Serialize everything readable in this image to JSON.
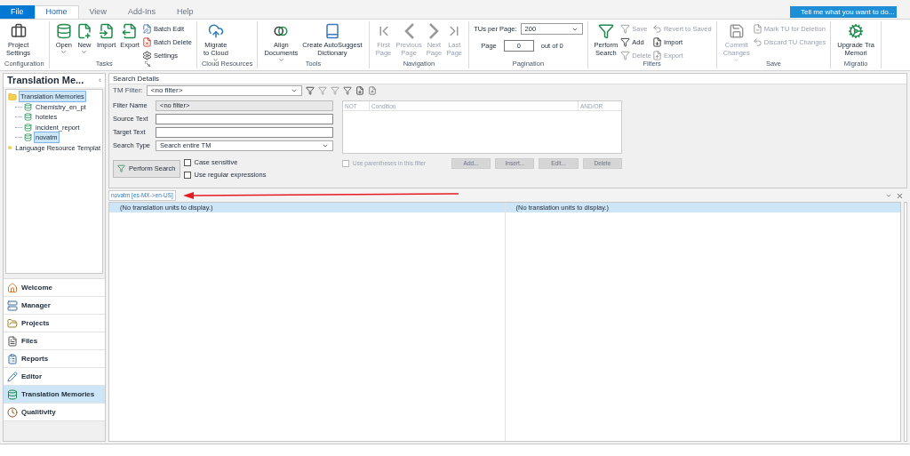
{
  "tabs": [
    {
      "label": "File",
      "kind": "file",
      "selected": false
    },
    {
      "label": "Home",
      "kind": "tab",
      "selected": true
    },
    {
      "label": "View",
      "kind": "tab",
      "selected": false
    },
    {
      "label": "Add-Ins",
      "kind": "tab",
      "selected": false
    },
    {
      "label": "Help",
      "kind": "tab",
      "selected": false
    }
  ],
  "tell_me": "Tell me what you want to do...",
  "ribbon": {
    "groups": [
      {
        "label": "Configuration",
        "items": [
          {
            "kind": "large",
            "lines": [
              "Project",
              "Settings"
            ],
            "disabled": false
          }
        ]
      },
      {
        "label": "Tasks",
        "launcher": true,
        "items": [
          {
            "kind": "large",
            "lines": [
              "Open"
            ],
            "dropdown": true,
            "disabled": false
          },
          {
            "kind": "large",
            "lines": [
              "New"
            ],
            "dropdown": true,
            "disabled": false
          },
          {
            "kind": "large",
            "lines": [
              "Import"
            ],
            "disabled": false
          },
          {
            "kind": "large",
            "lines": [
              "Export"
            ],
            "disabled": false
          },
          {
            "kind": "column",
            "items": [
              {
                "label": "Batch Edit",
                "disabled": false
              },
              {
                "label": "Batch Delete",
                "disabled": false
              },
              {
                "label": "Settings",
                "disabled": false
              }
            ]
          }
        ]
      },
      {
        "label": "Cloud Resources",
        "items": [
          {
            "kind": "large",
            "lines": [
              "Migrate",
              "to Cloud"
            ],
            "dropdown": true,
            "disabled": false
          }
        ]
      },
      {
        "label": "Tools",
        "items": [
          {
            "kind": "large",
            "lines": [
              "Align",
              "Documents"
            ],
            "dropdown": true,
            "disabled": false
          },
          {
            "kind": "large",
            "lines": [
              "Create AutoSuggest",
              "Dictionary"
            ],
            "disabled": false
          }
        ]
      },
      {
        "label": "Navigation",
        "items": [
          {
            "kind": "large",
            "lines": [
              "First",
              "Page"
            ],
            "disabled": true
          },
          {
            "kind": "large",
            "lines": [
              "Previous",
              "Page"
            ],
            "disabled": true
          },
          {
            "kind": "large",
            "lines": [
              "Next",
              "Page"
            ],
            "disabled": true
          },
          {
            "kind": "large",
            "lines": [
              "Last",
              "Page"
            ],
            "disabled": true
          }
        ]
      },
      {
        "label": "Pagination",
        "items": [
          {
            "kind": "pager",
            "per_page_label": "TUs per Page:",
            "per_page": "200",
            "page_label": "Page",
            "page": "0",
            "total": "out of 0"
          }
        ]
      },
      {
        "label": "Filters",
        "items": [
          {
            "kind": "large",
            "lines": [
              "Perform",
              "Search"
            ],
            "disabled": false
          },
          {
            "kind": "column",
            "items": [
              {
                "label": "Save",
                "disabled": true
              },
              {
                "label": "Add",
                "disabled": false
              },
              {
                "label": "Delete",
                "disabled": true
              }
            ]
          },
          {
            "kind": "column",
            "items": [
              {
                "label": "Revert to Saved",
                "disabled": true
              },
              {
                "label": "Import",
                "disabled": false
              },
              {
                "label": "Export",
                "disabled": true
              }
            ]
          }
        ]
      },
      {
        "label": "Save",
        "items": [
          {
            "kind": "large",
            "lines": [
              "Commit",
              "Changes"
            ],
            "dropdown": true,
            "disabled": true
          },
          {
            "kind": "column",
            "items": [
              {
                "label": "Mark TU for Deletion",
                "disabled": true
              },
              {
                "label": "Discard TU Changes",
                "disabled": true
              }
            ]
          }
        ]
      },
      {
        "label": "Migratio",
        "items": [
          {
            "kind": "large",
            "lines": [
              "Upgrade Tra",
              "Memori"
            ],
            "disabled": false
          }
        ]
      }
    ]
  },
  "sidebar": {
    "title": "Translation Me...",
    "collapse": "‹",
    "tree": [
      {
        "label": "Translation Memories",
        "selected": true,
        "children": [
          {
            "label": "Chemistry_en_pt",
            "selected": false
          },
          {
            "label": "hoteles",
            "selected": false
          },
          {
            "label": "incident_report",
            "selected": false
          },
          {
            "label": "novatm",
            "selected": true
          }
        ]
      },
      {
        "label": "Language Resource Templat",
        "selected": false
      }
    ],
    "nav": [
      {
        "label": "Welcome",
        "selected": false
      },
      {
        "label": "Manager",
        "selected": false
      },
      {
        "label": "Projects",
        "selected": false
      },
      {
        "label": "Files",
        "selected": false
      },
      {
        "label": "Reports",
        "selected": false
      },
      {
        "label": "Editor",
        "selected": false
      },
      {
        "label": "Translation Memories",
        "selected": true
      },
      {
        "label": "Qualitivity",
        "selected": false
      }
    ]
  },
  "search": {
    "title": "Search Details",
    "tm_filter_label": "TM Filter:",
    "tm_filter": "<no filter>",
    "fields": [
      {
        "label": "Filter Name",
        "kind": "readonly",
        "value": "<no filter>"
      },
      {
        "label": "Source Text",
        "kind": "text"
      },
      {
        "label": "Target Text",
        "kind": "text"
      },
      {
        "label": "Search Type",
        "kind": "select",
        "value": "Search entire TM"
      }
    ],
    "perform": "Perform Search",
    "options": [
      {
        "label": "Case sensitive",
        "checked": false
      },
      {
        "label": "Use regular expressions",
        "checked": false
      }
    ],
    "conditions": {
      "columns": [
        "NOT",
        "Condition",
        "AND/OR"
      ]
    },
    "parentheses": {
      "label": "Use parentheses in this filter",
      "checked": false,
      "disabled": true
    },
    "buttons": [
      {
        "label": "Add...",
        "disabled": true
      },
      {
        "label": "Insert...",
        "disabled": true
      },
      {
        "label": "Edit...",
        "disabled": true
      },
      {
        "label": "Delete",
        "disabled": true
      }
    ]
  },
  "document": {
    "tab": "novatm [es-MX->en-US]",
    "columns": [
      {
        "message": "(No translation units to display.)"
      },
      {
        "message": "(No translation units to display.)"
      }
    ]
  }
}
